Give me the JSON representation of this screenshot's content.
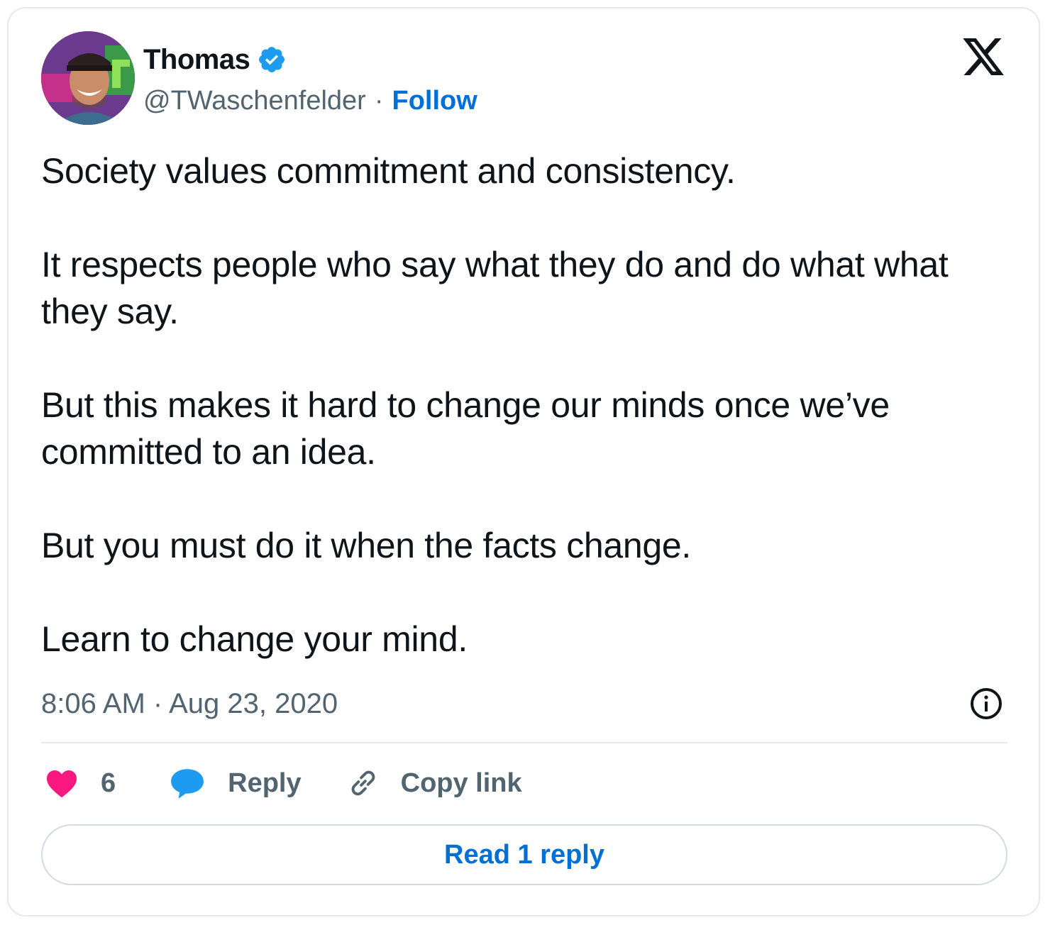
{
  "author": {
    "name": "Thomas",
    "verified": true,
    "handle": "@TWaschenfelder",
    "separator": "·",
    "follow_label": "Follow"
  },
  "platform_logo": "x-logo-icon",
  "tweet": {
    "paragraphs": [
      "Society values commitment and consistency.",
      "It respects people who say what they do and do what what they say.",
      "But this makes it hard to change our minds once we’ve committed to an idea.",
      "But you must do it when the facts change.",
      "Learn to change your mind."
    ],
    "timestamp": "8:06 AM · Aug 23, 2020"
  },
  "actions": {
    "like_count": "6",
    "reply_label": "Reply",
    "copy_link_label": "Copy link"
  },
  "read_replies_label": "Read 1 reply",
  "colors": {
    "text": "#0f1419",
    "secondary": "#536471",
    "link_blue": "#006fd6",
    "verified_blue": "#1d9bf0",
    "like_pink": "#f91880",
    "reply_blue": "#1d9bf0",
    "border": "#e6e8eb"
  }
}
